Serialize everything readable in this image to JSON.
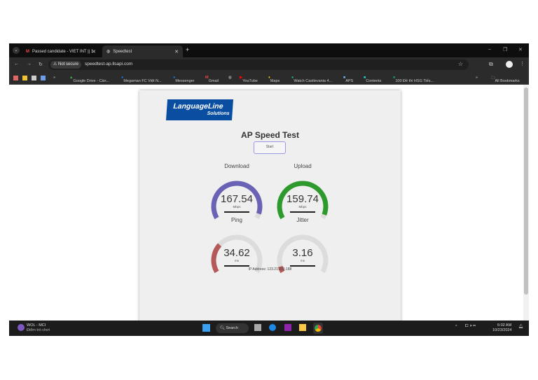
{
  "browser": {
    "tabs": [
      {
        "label": "Passed candidate - VIET INT || 1"
      },
      {
        "label": "Speedtest"
      }
    ],
    "security_label": "Not secure",
    "url": "speedtest-ap.llsapi.com",
    "bookmarks": [
      "Google Drive - Càn...",
      "Megaman FC Việt N...",
      "Messenger",
      "Gmail",
      "YouTube",
      "Maps",
      "Watch Castlevania 4...",
      "APS",
      "Contents",
      "100 Đề thi HSG Tiếs..."
    ],
    "all_bookmarks": "All Bookmarks"
  },
  "page": {
    "logo_line1": "LanguageLine",
    "logo_line2": "Solutions",
    "title": "AP Speed Test",
    "start_label": "Start",
    "gauges": [
      {
        "title": "Download",
        "value": "167.54",
        "unit": "Mbps",
        "fraction": 0.95,
        "color": "#6a62b4"
      },
      {
        "title": "Upload",
        "value": "159.74",
        "unit": "Mbps",
        "fraction": 0.96,
        "color": "#2e9a2e"
      },
      {
        "title": "Ping",
        "value": "34.62",
        "unit": "ms",
        "fraction": 0.3,
        "color": "#b55a5a"
      },
      {
        "title": "Jitter",
        "value": "3.16",
        "unit": "ms",
        "fraction": 0.06,
        "color": "#b55a5a"
      }
    ],
    "ip_label": "IP Address: 123.21.230.188"
  },
  "taskbar": {
    "notif_title": "WOL - MCI",
    "notif_sub": "Điểm trò chơi",
    "search": "Search",
    "time": "6:02 AM",
    "date": "10/23/2024"
  }
}
